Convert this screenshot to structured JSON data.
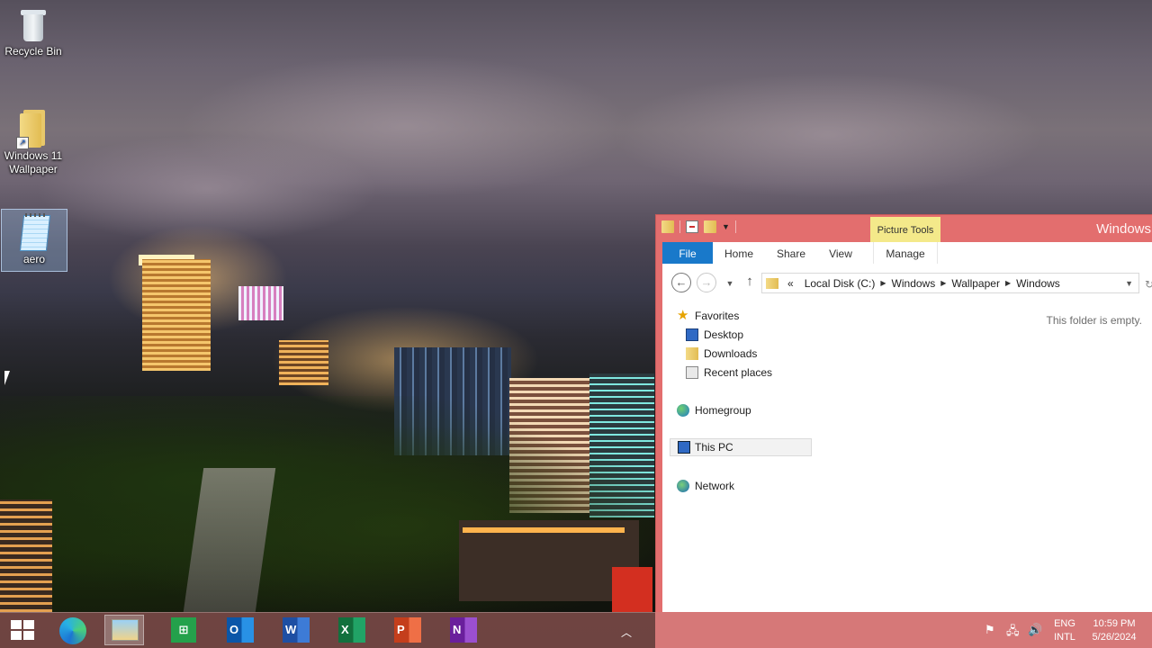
{
  "desktop": {
    "icons": [
      {
        "label": "Recycle Bin",
        "icon": "recycle-bin-icon"
      },
      {
        "label": "Windows 11 Wallpaper",
        "icon": "folder-shortcut-icon"
      },
      {
        "label": "aero",
        "icon": "notepad-file-icon"
      }
    ]
  },
  "explorer": {
    "title": "Windows",
    "context_tab": "Picture Tools",
    "ribbon_tabs": [
      "File",
      "Home",
      "Share",
      "View",
      "Manage"
    ],
    "address": {
      "overflow": "«",
      "crumbs": [
        "Local Disk (C:)",
        "Windows",
        "Wallpaper",
        "Windows"
      ]
    },
    "nav_tree": {
      "favorites": "Favorites",
      "desktop": "Desktop",
      "downloads": "Downloads",
      "recent": "Recent places",
      "homegroup": "Homegroup",
      "this_pc": "This PC",
      "network": "Network"
    },
    "empty_message": "This folder is empty."
  },
  "taskbar": {
    "apps": [
      "start-icon",
      "edge-icon",
      "file-explorer-icon",
      "store-icon",
      "outlook-icon",
      "word-icon",
      "excel-icon",
      "powerpoint-icon",
      "onenote-icon"
    ],
    "store_letter": "",
    "outlook_letter": "O",
    "word_letter": "W",
    "excel_letter": "X",
    "ppt_letter": "P",
    "onenote_letter": "N",
    "tray": {
      "lang_top": "ENG",
      "lang_bottom": "INTL",
      "time": "10:59 PM",
      "date": "5/26/2024"
    }
  },
  "colors": {
    "window_accent": "#e36e6e",
    "file_tab": "#1979ca",
    "context_tab": "#f4e98a"
  }
}
